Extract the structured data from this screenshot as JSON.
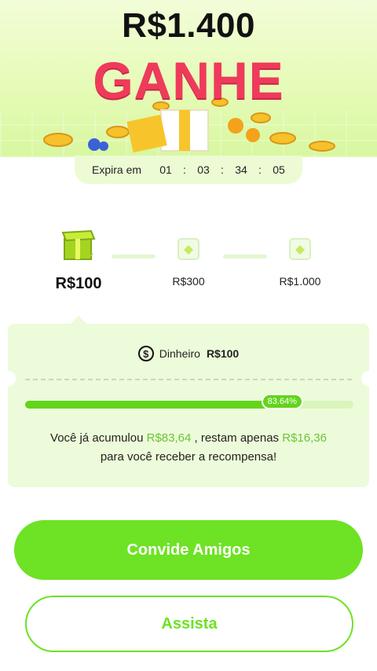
{
  "hero": {
    "amount": "R$1.400",
    "headline": "GANHE"
  },
  "timer": {
    "label": "Expira em",
    "hours": "01",
    "minutes": "03",
    "seconds": "34",
    "frames": "05",
    "separator": ":"
  },
  "tiers": [
    {
      "label": "R$100",
      "state": "active"
    },
    {
      "label": "R$300",
      "state": "locked"
    },
    {
      "label": "R$1.000",
      "state": "locked"
    }
  ],
  "reward_card": {
    "icon": "dollar-coin-icon",
    "type_label": "Dinheiro",
    "value_label": "R$100",
    "progress_fraction": 0.8364,
    "progress_label": "83.64%",
    "message": {
      "part1": "Você já acumulou ",
      "accumulated": "R$83,64",
      "part2": " , restam apenas ",
      "remaining": "R$16,36",
      "part3": "para você receber a recompensa!"
    }
  },
  "buttons": {
    "invite": "Convide Amigos",
    "watch": "Assista"
  },
  "colors": {
    "accent": "#6ee224",
    "headline": "#ef3b5b",
    "card_bg": "#ecfbd9",
    "highlight": "#6cc43a"
  }
}
